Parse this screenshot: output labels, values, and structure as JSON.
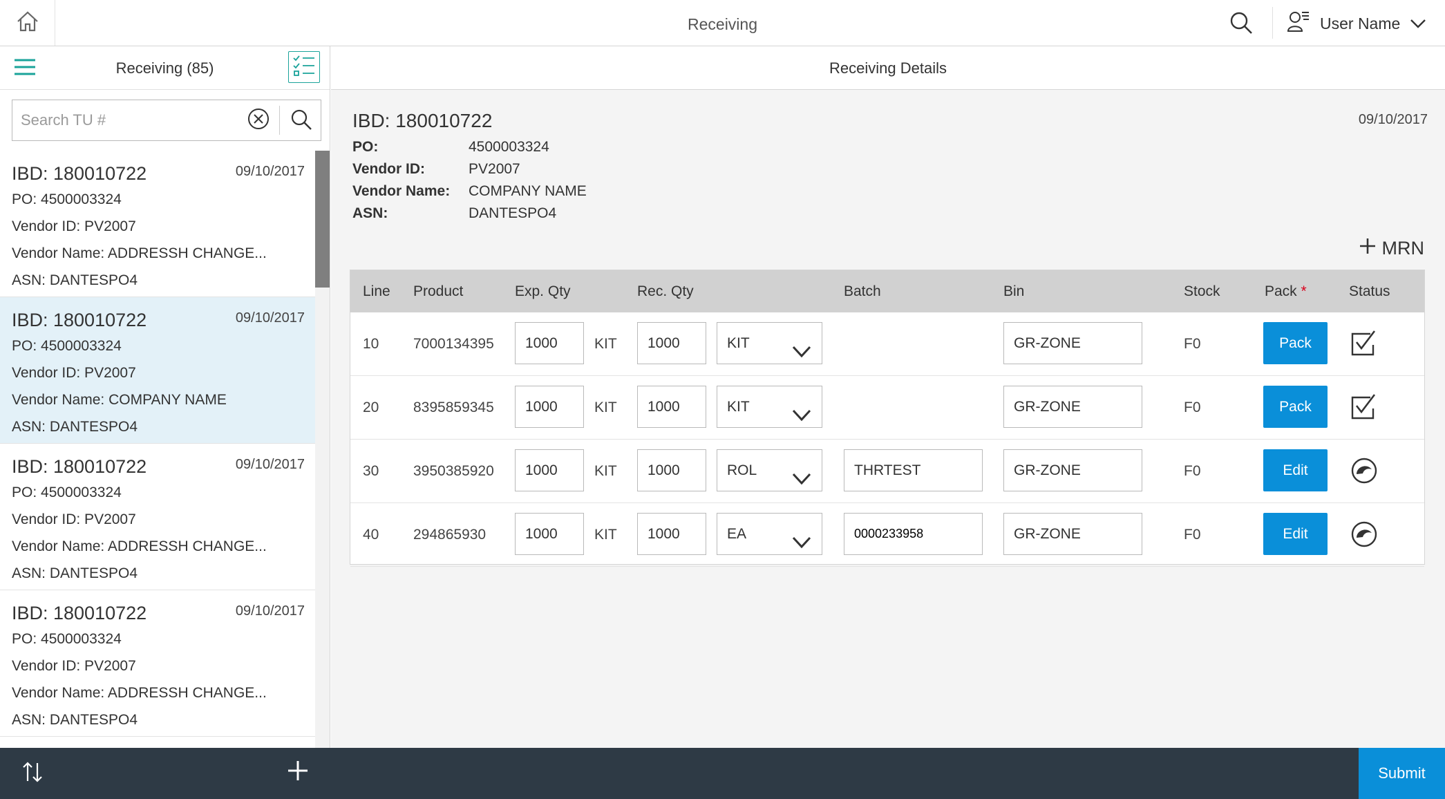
{
  "app": {
    "title": "Receiving"
  },
  "topbar": {
    "user_name": "User Name"
  },
  "left": {
    "title": "Receiving (85)",
    "search_placeholder": "Search TU #",
    "items": [
      {
        "ibd": "IBD: 180010722",
        "date": "09/10/2017",
        "po": "PO: 4500003324",
        "vendor_id": "Vendor ID: PV2007",
        "vendor_name": "Vendor Name: ADDRESSH CHANGE...",
        "asn": "ASN: DANTESPO4",
        "selected": false
      },
      {
        "ibd": "IBD: 180010722",
        "date": "09/10/2017",
        "po": "PO: 4500003324",
        "vendor_id": "Vendor ID: PV2007",
        "vendor_name": "Vendor Name: COMPANY NAME",
        "asn": "ASN: DANTESPO4",
        "selected": true
      },
      {
        "ibd": "IBD: 180010722",
        "date": "09/10/2017",
        "po": "PO: 4500003324",
        "vendor_id": "Vendor ID: PV2007",
        "vendor_name": "Vendor Name: ADDRESSH CHANGE...",
        "asn": "ASN: DANTESPO4",
        "selected": false
      },
      {
        "ibd": "IBD: 180010722",
        "date": "09/10/2017",
        "po": "PO: 4500003324",
        "vendor_id": "Vendor ID: PV2007",
        "vendor_name": "Vendor Name: ADDRESSH CHANGE...",
        "asn": "ASN: DANTESPO4",
        "selected": false
      }
    ]
  },
  "details": {
    "header": "Receiving Details",
    "ibd": "IBD: 180010722",
    "date": "09/10/2017",
    "fields": [
      {
        "label": "PO:",
        "value": "4500003324"
      },
      {
        "label": "Vendor ID:",
        "value": "PV2007"
      },
      {
        "label": "Vendor Name:",
        "value": "COMPANY NAME"
      },
      {
        "label": "ASN:",
        "value": "DANTESPO4"
      }
    ],
    "mrn_label": "MRN",
    "table": {
      "headers": {
        "line": "Line",
        "product": "Product",
        "exp_qty": "Exp. Qty",
        "rec_qty": "Rec. Qty",
        "batch": "Batch",
        "bin": "Bin",
        "stock": "Stock",
        "pack": "Pack",
        "pack_required": "*",
        "status": "Status"
      },
      "rows": [
        {
          "line": "10",
          "product": "7000134395",
          "exp_qty": "1000",
          "exp_uom": "KIT",
          "rec_qty": "1000",
          "rec_uom": "KIT",
          "batch": "",
          "bin": "GR-ZONE",
          "stock": "F0",
          "action": "Pack",
          "status_icon": "check-icon"
        },
        {
          "line": "20",
          "product": "8395859345",
          "exp_qty": "1000",
          "exp_uom": "KIT",
          "rec_qty": "1000",
          "rec_uom": "KIT",
          "batch": "",
          "bin": "GR-ZONE",
          "stock": "F0",
          "action": "Pack",
          "status_icon": "check-icon"
        },
        {
          "line": "30",
          "product": "3950385920",
          "exp_qty": "1000",
          "exp_uom": "KIT",
          "rec_qty": "1000",
          "rec_uom": "ROL",
          "batch": "THRTEST",
          "bin": "GR-ZONE",
          "stock": "F0",
          "action": "Edit",
          "status_icon": "pending-icon"
        },
        {
          "line": "40",
          "product": "294865930",
          "exp_qty": "1000",
          "exp_uom": "KIT",
          "rec_qty": "1000",
          "rec_uom": "EA",
          "batch": "0000233958",
          "bin": "GR-ZONE",
          "stock": "F0",
          "action": "Edit",
          "status_icon": "pending-icon"
        }
      ]
    }
  },
  "bottombar": {
    "submit_label": "Submit"
  },
  "colors": {
    "accent": "#0a8fd9",
    "teal": "#1aa39a",
    "footer": "#2e3a45",
    "selected_row": "#e3f1f8",
    "table_header": "#d1d1d1"
  }
}
